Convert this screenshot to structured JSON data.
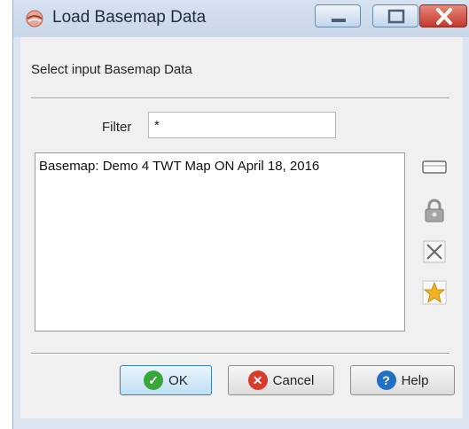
{
  "window": {
    "title": "Load Basemap Data",
    "icon": "basemap-app-icon",
    "controls": {
      "minimize": "minimize-icon",
      "maximize": "maximize-icon",
      "close": "close-icon"
    }
  },
  "dialog": {
    "subtitle": "Select input Basemap Data",
    "filter": {
      "label": "Filter",
      "value": "*"
    },
    "list": {
      "items": [
        "Basemap: Demo 4 TWT Map ON April 18, 2016"
      ]
    },
    "side_tools": [
      "blank-box-icon",
      "lock-icon",
      "delete-x-icon",
      "star-icon"
    ],
    "buttons": {
      "ok": "OK",
      "cancel": "Cancel",
      "help": "Help"
    }
  },
  "colors": {
    "ok_icon": "#3aa53a",
    "cancel_icon": "#d93a2b",
    "help_icon": "#1f6fc5",
    "star": "#f2b323"
  }
}
